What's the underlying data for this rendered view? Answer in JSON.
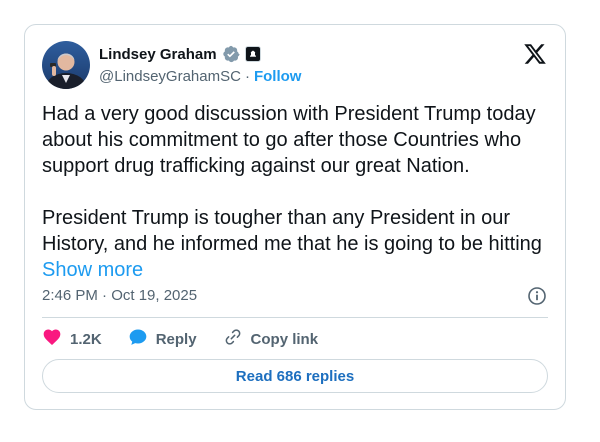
{
  "author": {
    "name": "Lindsey Graham",
    "handle": "@LindseyGrahamSC",
    "separator": "·",
    "follow_label": "Follow"
  },
  "tweet": {
    "paragraphs": [
      "Had a very good discussion with President Trump today about his commitment to go after those Countries who support drug trafficking against our great Nation.",
      "President Trump is tougher than any President in our History, and he informed me that he is going to be hitting"
    ],
    "show_more_label": "Show more",
    "timestamp": "2:46 PM · Oct 19, 2025"
  },
  "actions": {
    "like_count": "1.2K",
    "reply_label": "Reply",
    "copy_link_label": "Copy link"
  },
  "read_replies_label": "Read 686 replies",
  "icons": {
    "brand": "x-logo-icon",
    "verified": "verified-badge-icon",
    "affiliation": "affiliation-badge-icon",
    "info": "info-icon",
    "like": "heart-icon",
    "reply": "speech-bubble-icon",
    "copy_link": "link-icon"
  },
  "colors": {
    "link_blue": "#1d9bf0",
    "like_pink": "#f91880",
    "text_secondary": "#536471",
    "border": "#cfd9de"
  }
}
